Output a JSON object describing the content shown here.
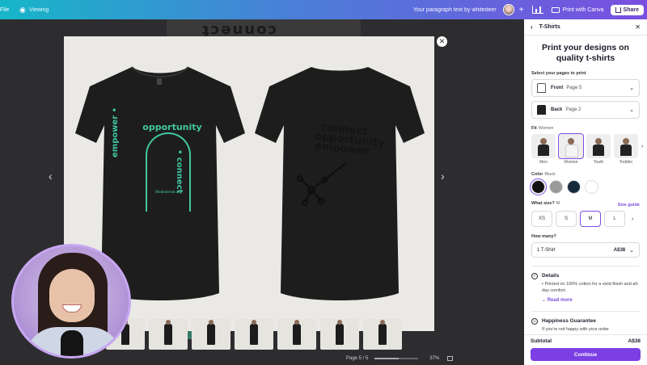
{
  "topbar": {
    "file_label": "File",
    "viewing_label": "Viewing",
    "doc_title": "Your paragraph text by whitedeer",
    "print_label": "Print with Canva",
    "share_label": "Share"
  },
  "preview": {
    "front_arch_text": "opportunity",
    "front_left_text": "empower •",
    "front_right_text": "• connect",
    "front_url": "filledinternal.org",
    "back_text_lines": [
      "connect",
      "opportunity",
      "empower"
    ]
  },
  "pagebar": {
    "page_label": "Page 5 / 5",
    "zoom_label": "37%"
  },
  "panel": {
    "tab_title": "T-Shirts",
    "heading_line1": "Print your designs on",
    "heading_line2": "quality t-shirts",
    "pages_label": "Select your pages to print",
    "pages": [
      {
        "name": "Front",
        "page": "Page 5"
      },
      {
        "name": "Back",
        "page": "Page 2"
      }
    ],
    "fit_label": "Fit",
    "fit_value": "Women",
    "fits": [
      "Men",
      "Women",
      "Youth",
      "Toddler"
    ],
    "color_label": "Color",
    "color_value": "Black",
    "colors": [
      "#111111",
      "#9a9a9a",
      "#172a3c",
      "#ffffff"
    ],
    "size_label": "What size?",
    "size_value": "M",
    "size_guide": "Size guide",
    "sizes": [
      "XS",
      "S",
      "M",
      "L"
    ],
    "qty_label": "How many?",
    "qty_value": "1 T-Shirt",
    "qty_price": "A$38",
    "details_title": "Details",
    "details_text": "• Printed on 100% cotton for a vivid finish and all-day comfort.",
    "read_more": "Read more",
    "guarantee_title": "Happiness Guarantee",
    "guarantee_text": "If you're not happy with your order",
    "subtotal_label": "Subtotal",
    "subtotal_value": "A$38",
    "continue_label": "Continue"
  },
  "accent_color": "#7b3fe4"
}
